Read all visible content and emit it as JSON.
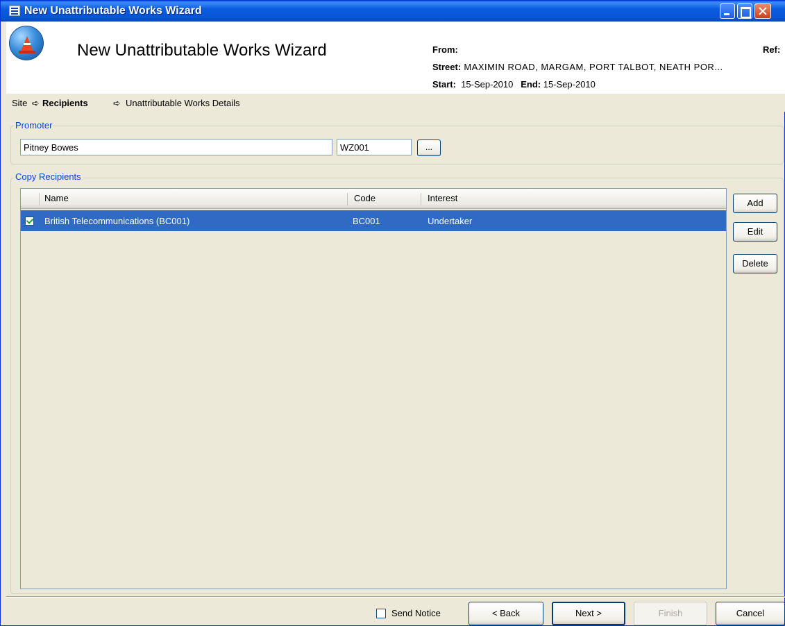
{
  "window": {
    "title": "New Unattributable Works Wizard"
  },
  "header": {
    "title": "New Unattributable Works Wizard",
    "from_label": "From:",
    "ref_label": "Ref:",
    "street_label": "Street:",
    "street_value": "MAXIMIN ROAD, MARGAM, PORT TALBOT, NEATH POR...",
    "start_label": "Start:",
    "start_value": "15-Sep-2010",
    "end_label": "End:",
    "end_value": "15-Sep-2010"
  },
  "breadcrumb": {
    "step1": "Site",
    "arrow": "➪",
    "step2": "Recipients",
    "step3": "Unattributable Works Details"
  },
  "promoter": {
    "legend": "Promoter",
    "name": "Pitney Bowes",
    "code": "WZ001",
    "lookup_label": "..."
  },
  "recipients": {
    "legend": "Copy Recipients",
    "columns": [
      "Name",
      "Code",
      "Interest"
    ],
    "rows": [
      {
        "checked": true,
        "name": "British Telecommunications (BC001)",
        "code": "BC001",
        "interest": "Undertaker"
      }
    ],
    "buttons": {
      "add": "Add",
      "edit": "Edit",
      "delete": "Delete"
    }
  },
  "footer": {
    "send_notice_label": "Send Notice",
    "send_notice_checked": false,
    "back": "< Back",
    "next": "Next >",
    "finish": "Finish",
    "cancel": "Cancel"
  },
  "colors": {
    "selection": "#316ac5",
    "titlebar": "#0a5ce0",
    "legend_text": "#0046d5",
    "dialog_bg": "#ece9d8"
  }
}
